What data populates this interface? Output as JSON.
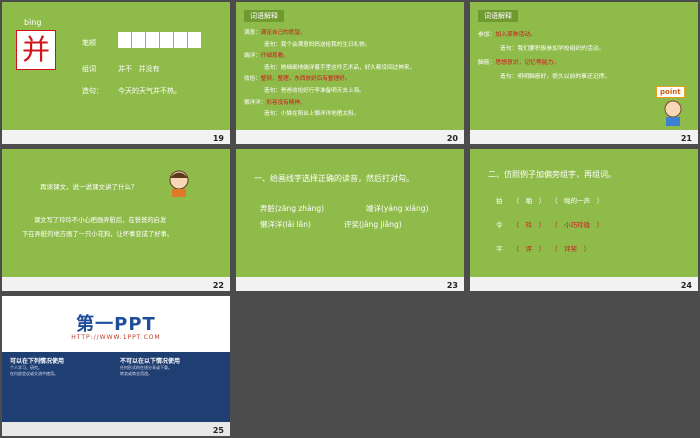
{
  "s19": {
    "pinyin": "bìng",
    "character": "并",
    "stroke_label": "笔顺",
    "words_label": "组词",
    "words": "并不   并没有",
    "sentence_label": "造句：",
    "sentence": "今天的天气并不热。",
    "page": "19"
  },
  "s20": {
    "tag": "词语解释",
    "lines": [
      {
        "term": "满意：",
        "def": "满足自己的愿望。"
      },
      {
        "term": "",
        "def": "造句：我个会满意妈妈送给我的生日礼物。"
      },
      {
        "term": "端详：",
        "def": "仔细观看。"
      },
      {
        "term": "",
        "def": "造句：她细细地端详着手里这件艺术品，好久都没回过神来。"
      },
      {
        "term": "收拾：",
        "def": "整顿，整理。东西放好后有整理好。"
      },
      {
        "term": "",
        "def": "造句：爸爸收拾好行李准备明天去上海。"
      },
      {
        "term": "懒洋洋：",
        "def": "形容没有精神、"
      },
      {
        "term": "",
        "def": "造句：小猫在阳台上懒洋洋地晒太阳。"
      }
    ],
    "page": "20"
  },
  "s21": {
    "tag": "词语解释",
    "lines": [
      {
        "term": "参加：",
        "def": "加入某种活动。"
      },
      {
        "term": "",
        "def": "造句：我们要积极参加学校组织的活动。"
      },
      {
        "term": "脑筋：",
        "def": "思想意识，记忆等能力。"
      },
      {
        "term": "",
        "def": "造句：明明脑筋好，很久以前的事还记得。"
      }
    ],
    "point_label": "point",
    "page": "21"
  },
  "s22": {
    "question": "再读课文，说一说课文讲了什么？",
    "text_line1": "课文写了玲玲不小心把画弄脏后，在爸爸的启发",
    "text_line2": "下在弄脏的地方画了一只小花狗，让坏事变成了好事。",
    "page": "22"
  },
  "s23": {
    "instruction": "一、给画线字选择正确的读音，然后打对勾。",
    "items": [
      {
        "word": "弄脏",
        "reading": "(zāng zhàng)"
      },
      {
        "word": "端详",
        "reading": "(yáng xiáng)"
      },
      {
        "word": "懒洋洋",
        "reading": "(lǎi lǎn)"
      },
      {
        "word": "评奖",
        "reading": "(jǎng jiǎng)"
      }
    ],
    "page": "23"
  },
  "s24": {
    "instruction": "二、仿照例子加偏旁组字，再组词。",
    "rows": [
      {
        "base": "拍",
        "char": "（　啪　）",
        "word": "（　啪的一声　）"
      },
      {
        "base": "令",
        "char": "（　玲　）",
        "word": "（　小巧玲珑　）"
      },
      {
        "base": "平",
        "char": "（　评　）",
        "word": "（　评奖　）"
      }
    ],
    "page": "24"
  },
  "s25": {
    "logo": "第一PPT",
    "url": "HTTP://WWW.1PPT.COM",
    "can_title": "可以在下列情况使用",
    "cannot_title": "不可以在以下情况使用",
    "can_lines": [
      "个人学习、研究。",
      "在内部会议或交流中使用。"
    ],
    "cannot_lines": [
      "任何形式的在线分享或下载。",
      "转卖或商业用途。"
    ],
    "page": "25"
  },
  "colors": {
    "slide_bg": "#8fbb4b",
    "page_bg": "#4c4c4c",
    "accent_red": "#d0141c",
    "blue_band": "#1f3f73"
  }
}
